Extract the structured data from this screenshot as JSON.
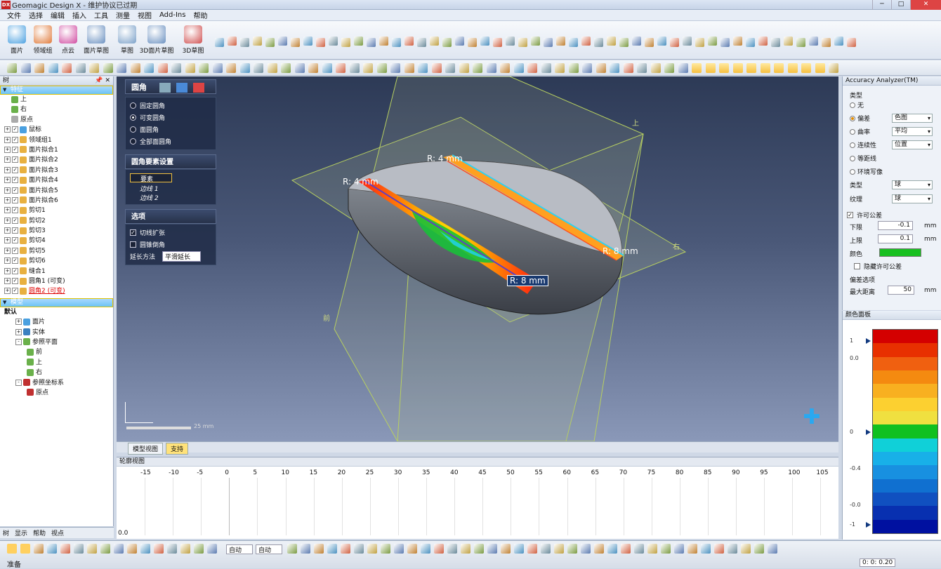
{
  "app": {
    "title": "Geomagic Design X - 维护协议已过期",
    "logo": "DX"
  },
  "menu": [
    "文件",
    "选择",
    "编辑",
    "插入",
    "工具",
    "测量",
    "视图",
    "Add-Ins",
    "帮助"
  ],
  "ribbon": {
    "buttons": [
      {
        "label": "面片",
        "color": "#4aa0e0",
        "icon": "mesh-icon"
      },
      {
        "label": "领域组",
        "color": "#e07a3a",
        "icon": "region-group-icon"
      },
      {
        "label": "点云",
        "color": "#d04aa0",
        "icon": "point-cloud-icon"
      },
      {
        "label": "面片草图",
        "color": "#6a90c0",
        "icon": "mesh-sketch-icon"
      },
      {
        "label": "草图",
        "color": "#7aa0c8",
        "icon": "sketch-icon"
      },
      {
        "label": "3D面片草图",
        "color": "#6a90c0",
        "icon": "3d-mesh-sketch-icon"
      },
      {
        "label": "3D草图",
        "color": "#d05050",
        "icon": "3d-sketch-icon"
      }
    ]
  },
  "tree": {
    "header": "树",
    "feature_section": "特征",
    "feature_items": [
      {
        "label": "上",
        "icon": "plane-icon",
        "exp": ""
      },
      {
        "label": "右",
        "icon": "plane-icon",
        "exp": ""
      },
      {
        "label": "原点",
        "icon": "origin-icon",
        "exp": ""
      },
      {
        "label": "鼠标",
        "icon": "mesh-icon",
        "exp": "+"
      },
      {
        "label": "领域组1",
        "icon": "region-group-icon",
        "exp": "+"
      },
      {
        "label": "面片拟合1",
        "icon": "surface-fit-icon",
        "exp": "+"
      },
      {
        "label": "面片拟合2",
        "icon": "surface-fit-icon",
        "exp": "+"
      },
      {
        "label": "面片拟合3",
        "icon": "surface-fit-icon",
        "exp": "+"
      },
      {
        "label": "面片拟合4",
        "icon": "surface-fit-icon",
        "exp": "+"
      },
      {
        "label": "面片拟合5",
        "icon": "surface-fit-icon",
        "exp": "+"
      },
      {
        "label": "面片拟合6",
        "icon": "surface-fit-icon",
        "exp": "+"
      },
      {
        "label": "剪切1",
        "icon": "trim-icon",
        "exp": "+"
      },
      {
        "label": "剪切2",
        "icon": "trim-icon",
        "exp": "+"
      },
      {
        "label": "剪切3",
        "icon": "trim-icon",
        "exp": "+"
      },
      {
        "label": "剪切4",
        "icon": "trim-icon",
        "exp": "+"
      },
      {
        "label": "剪切5",
        "icon": "trim-icon",
        "exp": "+"
      },
      {
        "label": "剪切6",
        "icon": "trim-icon",
        "exp": "+"
      },
      {
        "label": "缝合1",
        "icon": "sew-icon",
        "exp": "+"
      },
      {
        "label": "圆角1 (可变)",
        "icon": "fillet-icon",
        "exp": "+"
      },
      {
        "label": "圆角2 (可变)",
        "icon": "fillet-icon",
        "exp": "+",
        "red": true
      }
    ],
    "model_section": "模型",
    "model_items": [
      {
        "label": "默认",
        "indent": 0,
        "exp": "",
        "bold": true
      },
      {
        "label": "面片",
        "indent": 1,
        "exp": "+",
        "icon": "mesh-icon"
      },
      {
        "label": "实体",
        "indent": 1,
        "exp": "+",
        "icon": "solid-icon"
      },
      {
        "label": "参照平面",
        "indent": 1,
        "exp": "-",
        "icon": "plane-icon"
      },
      {
        "label": "前",
        "indent": 2,
        "exp": "",
        "icon": "plane-icon"
      },
      {
        "label": "上",
        "indent": 2,
        "exp": "",
        "icon": "plane-icon"
      },
      {
        "label": "右",
        "indent": 2,
        "exp": "",
        "icon": "plane-icon"
      },
      {
        "label": "参照坐标系",
        "indent": 1,
        "exp": "-",
        "icon": "coordinate-icon"
      },
      {
        "label": "原点",
        "indent": 2,
        "exp": "",
        "icon": "origin-icon"
      }
    ],
    "bottom_tabs": [
      "树",
      "显示",
      "帮助",
      "视点"
    ]
  },
  "fillet_panel": {
    "title": "圆角",
    "modes": [
      "固定圆角",
      "可变圆角",
      "面圆角",
      "全部面圆角"
    ],
    "selected_mode": 1,
    "element_section": "圆角要素设置",
    "element_label": "要素",
    "edges": [
      "边线 1",
      "边线 2"
    ],
    "options_section": "选项",
    "tangent_expand": "切线扩张",
    "tangent_checked": true,
    "conic": "圆锥倒角",
    "conic_checked": false,
    "extend_label": "延长方法",
    "extend_value": "平滑延长"
  },
  "viewport": {
    "labels": [
      {
        "text": "R: 4 mm"
      },
      {
        "text": "R: 4 mm"
      },
      {
        "text": "R: 8 mm"
      },
      {
        "text": "R: 8 mm"
      }
    ],
    "plane_labels": [
      "上",
      "右",
      "前"
    ],
    "scale": "25 mm"
  },
  "view_tabs": [
    "模型视图",
    "支持"
  ],
  "profile": {
    "title": "轮廓视图",
    "ticks": [
      "-15",
      "-10",
      "-5",
      "0",
      "5",
      "10",
      "15",
      "20",
      "25",
      "30",
      "35",
      "40",
      "45",
      "50",
      "55",
      "60",
      "65",
      "70",
      "75",
      "80",
      "85",
      "90",
      "95",
      "100",
      "105"
    ],
    "zero_label": "0.0"
  },
  "accuracy": {
    "title": "Accuracy Analyzer(TM)",
    "type_label": "类型",
    "options": [
      {
        "label": "无",
        "value": ""
      },
      {
        "label": "偏差",
        "value": "色图"
      },
      {
        "label": "曲率",
        "value": "平均"
      },
      {
        "label": "连续性",
        "value": "位置"
      },
      {
        "label": "等距线",
        "value": ""
      },
      {
        "label": "环境写像",
        "value": ""
      }
    ],
    "selected": 1,
    "kind_label": "类型",
    "kind_value": "球",
    "texture_label": "纹理",
    "texture_value": "球",
    "tolerance_label": "许可公差",
    "lower_label": "下限",
    "lower_value": "-0.1",
    "lower_unit": "mm",
    "upper_label": "上限",
    "upper_value": "0.1",
    "upper_unit": "mm",
    "color_label": "颜色",
    "hide_label": "隐藏许可公差",
    "dev_options_label": "偏差选项",
    "max_dist_label": "最大距离",
    "max_dist_value": "50",
    "max_dist_unit": "mm"
  },
  "color_panel": {
    "title": "颜色面板",
    "labels": [
      "1",
      "0.0",
      "0",
      "-0.4",
      "-0.0",
      "-1"
    ],
    "colors": [
      "#d40000",
      "#e83000",
      "#f06010",
      "#f48a10",
      "#f8b020",
      "#fcd030",
      "#f0e040",
      "#10c020",
      "#10d0d8",
      "#18b0e8",
      "#1890e0",
      "#1070d0",
      "#1050c0",
      "#0830b0",
      "#0010a0"
    ]
  },
  "status": {
    "ready": "准备",
    "mode1": "自动",
    "mode2": "自动",
    "time": "0: 0: 0.20"
  }
}
